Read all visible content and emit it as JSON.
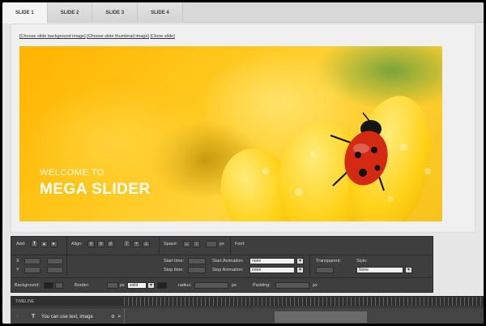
{
  "tabs": [
    {
      "label": "SLIDE 1",
      "active": true
    },
    {
      "label": "SLIDE 2",
      "active": false
    },
    {
      "label": "SLIDE 3",
      "active": false
    },
    {
      "label": "SLIDE 4",
      "active": false
    }
  ],
  "links": {
    "bg": "[Choose slide background image]",
    "thumb": "[Choose slide thumbnail image]",
    "clone": "[Clone slide]"
  },
  "slide": {
    "welcome": "WELCOME TO",
    "title": "MEGA SLIDER"
  },
  "editor": {
    "add_label": "Add:",
    "align_label": "Align:",
    "space_label": "Space:",
    "space_unit": "px",
    "font_label": "Font:",
    "x_label": "X",
    "y_label": "Y",
    "start_time_label": "Start time:",
    "stop_time_label": "Stop time:",
    "start_anim_label": "Start Animation:",
    "stop_anim_label": "Stop Animation:",
    "start_anim_value": "none",
    "stop_anim_value": "none",
    "transparent_label": "Transparent:",
    "style_label": "Style:",
    "style_value": "None",
    "background_label": "Background:",
    "border_label": "Border:",
    "border_unit": "px",
    "border_style": "solid",
    "radius_label": "radius:",
    "radius_unit": "px",
    "padding_label": "Padding:",
    "padding_unit": "px"
  },
  "timeline": {
    "title": "TIMELINE",
    "layer_text": "You can use text, image"
  },
  "colors": {
    "tab_bg": "#d9d9d9",
    "editor_bg": "#3e3e3e",
    "accent_yellow": "#ffc61a",
    "ladybug_red": "#d42a14"
  }
}
